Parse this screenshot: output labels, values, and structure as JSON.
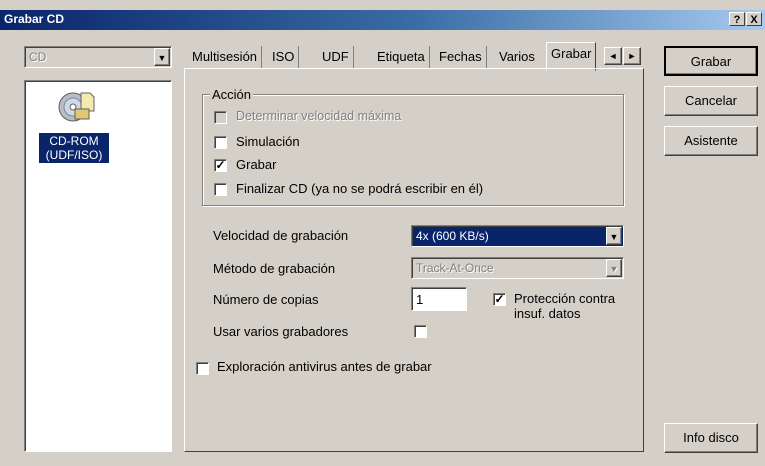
{
  "window": {
    "title": "Grabar CD",
    "help_btn": "?",
    "close_btn": "X"
  },
  "left": {
    "drive_combo": "CD",
    "item_label_line1": "CD-ROM",
    "item_label_line2": "(UDF/ISO)"
  },
  "tabs": [
    "Multisesión",
    "ISO",
    "UDF",
    "Etiqueta",
    "Fechas",
    "Varios",
    "Grabar"
  ],
  "tab_scroll": {
    "left": "◄",
    "right": "►"
  },
  "action_group": {
    "legend": "Acción",
    "items": [
      {
        "label": "Determinar velocidad máxima",
        "checked": false,
        "disabled": true
      },
      {
        "label": "Simulación",
        "checked": false,
        "disabled": false
      },
      {
        "label": "Grabar",
        "checked": true,
        "disabled": false
      },
      {
        "label": "Finalizar CD (ya no se podrá escribir en él)",
        "checked": false,
        "disabled": false
      }
    ]
  },
  "settings": {
    "speed_label": "Velocidad de grabación",
    "speed_value": "4x (600 KB/s)",
    "method_label": "Método de grabación",
    "method_value": "Track-At-Once",
    "copies_label": "Número de copias",
    "copies_value": "1",
    "protection_label_1": "Protección contra",
    "protection_label_2": "insuf. datos",
    "protection_checked": true,
    "multi_label": "Usar varios grabadores",
    "multi_checked": false
  },
  "antivirus": {
    "label": "Exploración antivirus antes de grabar",
    "checked": false
  },
  "buttons": {
    "burn": "Grabar",
    "cancel": "Cancelar",
    "wizard": "Asistente",
    "disc_info": "Info disco"
  },
  "colors": {
    "titlebar": "#0a246a",
    "selection": "#0a246a",
    "face": "#d4d0c8"
  }
}
